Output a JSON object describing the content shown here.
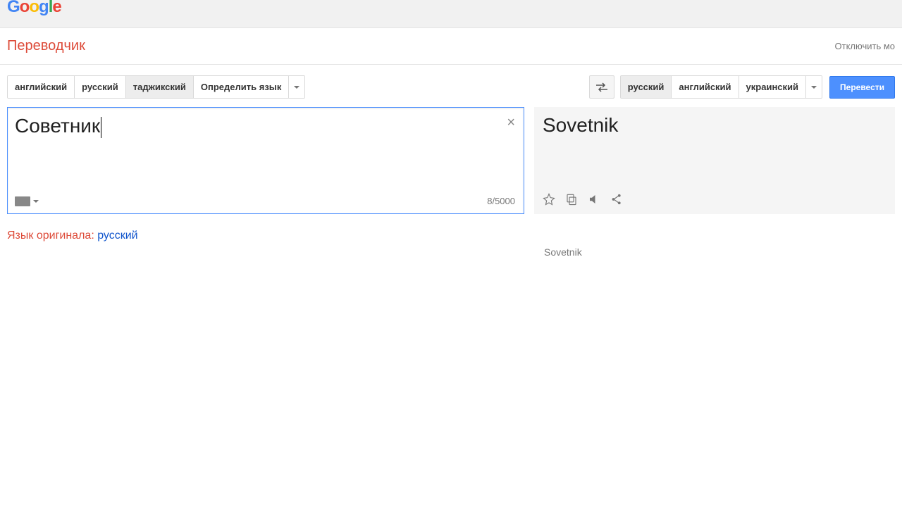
{
  "header": {
    "logo": "Google",
    "app_title": "Переводчик",
    "instant_link": "Отключить мо"
  },
  "source_langs": {
    "items": [
      "английский",
      "русский",
      "таджикский",
      "Определить язык"
    ],
    "selected_index": 2
  },
  "target_langs": {
    "items": [
      "русский",
      "английский",
      "украинский"
    ],
    "selected_index": 0
  },
  "translate_button": "Перевести",
  "source": {
    "text": "Советник",
    "char_count": "8/5000"
  },
  "target": {
    "text": "Sovetnik",
    "transliteration": "Sovetnik"
  },
  "detected": {
    "label": "Язык оригинала: ",
    "lang": "русский"
  }
}
